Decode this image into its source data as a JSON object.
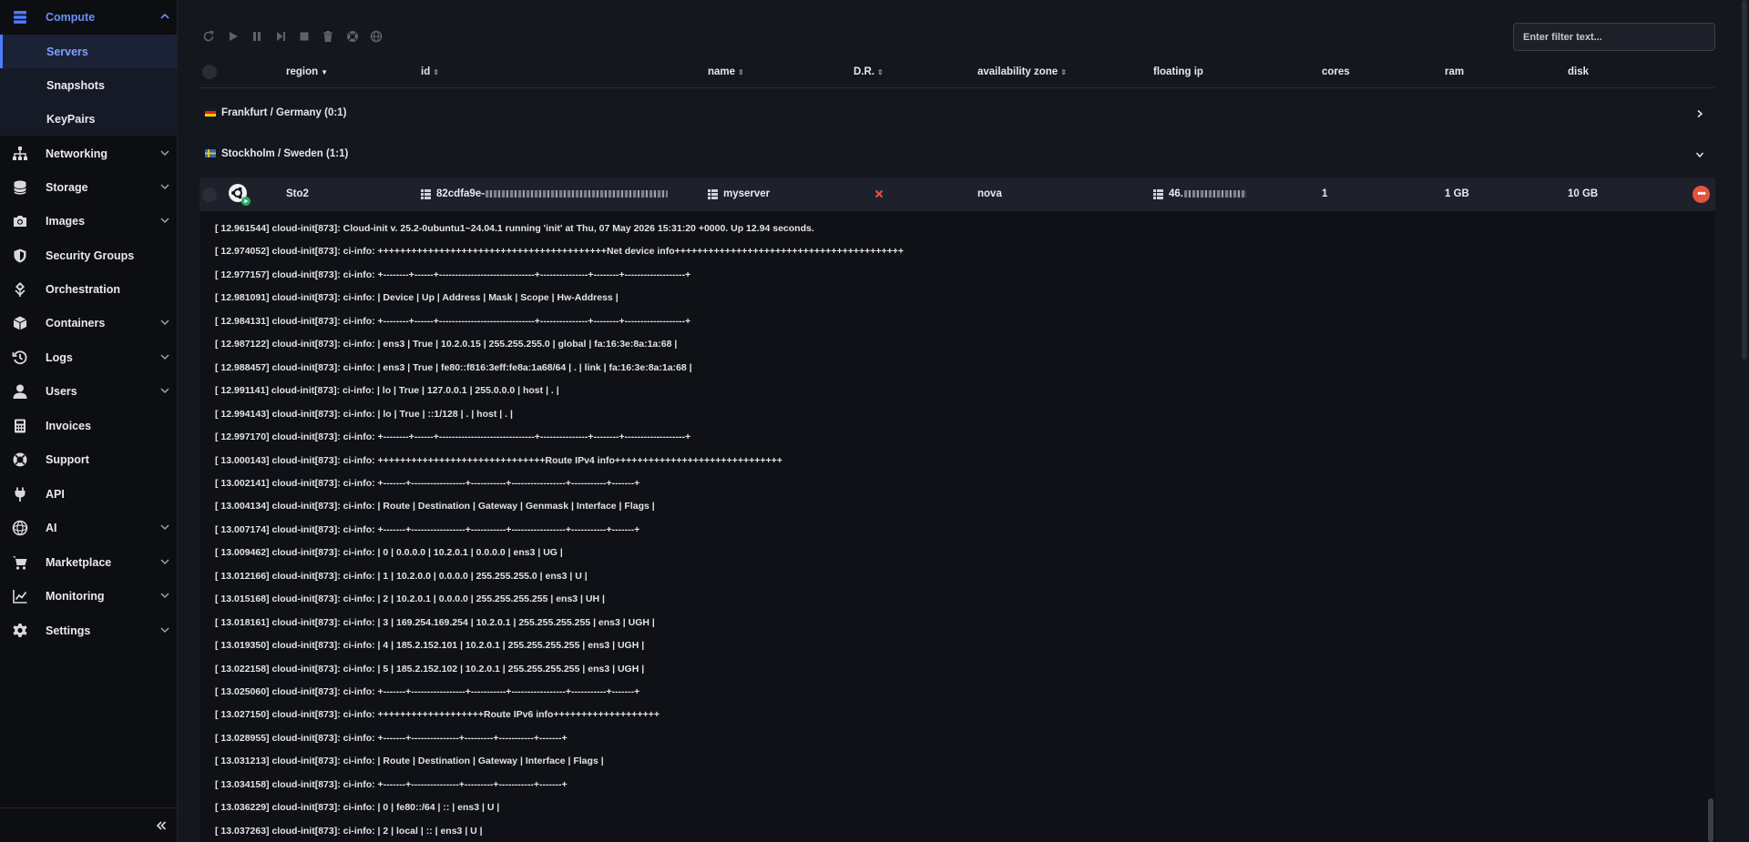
{
  "colors": {
    "accent": "#4f7cff",
    "danger": "#e5533d",
    "background": "#15171e",
    "sidebar": "#0d0e12"
  },
  "sidebar": {
    "items": [
      {
        "key": "compute",
        "label": "Compute",
        "icon": "server-stack-icon",
        "expanded": true
      },
      {
        "key": "networking",
        "label": "Networking",
        "icon": "network-icon",
        "expanded": false
      },
      {
        "key": "storage",
        "label": "Storage",
        "icon": "database-icon",
        "expanded": false
      },
      {
        "key": "images",
        "label": "Images",
        "icon": "camera-icon",
        "expanded": false
      },
      {
        "key": "security-groups",
        "label": "Security Groups",
        "icon": "shield-icon"
      },
      {
        "key": "orchestration",
        "label": "Orchestration",
        "icon": "orchestration-icon"
      },
      {
        "key": "containers",
        "label": "Containers",
        "icon": "cube-icon",
        "expanded": false
      },
      {
        "key": "logs",
        "label": "Logs",
        "icon": "history-icon",
        "expanded": false
      },
      {
        "key": "users",
        "label": "Users",
        "icon": "user-icon",
        "expanded": false
      },
      {
        "key": "invoices",
        "label": "Invoices",
        "icon": "calculator-icon"
      },
      {
        "key": "support",
        "label": "Support",
        "icon": "lifebuoy-icon"
      },
      {
        "key": "api",
        "label": "API",
        "icon": "plug-icon"
      },
      {
        "key": "ai",
        "label": "AI",
        "icon": "ai-icon",
        "expanded": false
      },
      {
        "key": "marketplace",
        "label": "Marketplace",
        "icon": "cart-icon",
        "expanded": false
      },
      {
        "key": "monitoring",
        "label": "Monitoring",
        "icon": "chart-line-icon",
        "expanded": false
      },
      {
        "key": "settings",
        "label": "Settings",
        "icon": "gear-icon",
        "expanded": false
      }
    ],
    "compute_sub": [
      {
        "label": "Servers",
        "active": true
      },
      {
        "label": "Snapshots",
        "active": false
      },
      {
        "label": "KeyPairs",
        "active": false
      }
    ],
    "collapse_icon": "double-chevron-left-icon"
  },
  "toolbar": {
    "icons": [
      "refresh-icon",
      "play-icon",
      "pause-icon",
      "skip-icon",
      "stop-icon",
      "trash-icon",
      "lifebuoy-icon",
      "globe-icon"
    ],
    "filter_placeholder": "Enter filter text..."
  },
  "table": {
    "columns": [
      {
        "label": "region",
        "sort": "desc"
      },
      {
        "label": "id",
        "sort": "none"
      },
      {
        "label": "name",
        "sort": "none"
      },
      {
        "label": "D.R.",
        "sort": "none"
      },
      {
        "label": "availability zone",
        "sort": "none"
      },
      {
        "label": "floating ip"
      },
      {
        "label": "cores"
      },
      {
        "label": "ram"
      },
      {
        "label": "disk"
      }
    ],
    "groups": [
      {
        "label": "Frankfurt / Germany (0:1)",
        "flag": "de",
        "expanded": false
      },
      {
        "label": "Stockholm / Sweden (1:1)",
        "flag": "se",
        "expanded": true
      }
    ],
    "server": {
      "region": "Sto2",
      "id_prefix": "82cdfa9e-",
      "name": "myserver",
      "dr": "disabled",
      "availability_zone": "nova",
      "floating_ip_prefix": "46.",
      "cores": "1",
      "ram": "1 GB",
      "disk": "10 GB",
      "status": "running"
    }
  },
  "console": {
    "lines": [
      "[ 12.961544] cloud-init[873]: Cloud-init v. 25.2-0ubuntu1~24.04.1 running 'init' at Thu, 07 May 2026 15:31:20 +0000. Up 12.94 seconds.",
      "[ 12.974052] cloud-init[873]: ci-info: +++++++++++++++++++++++++++++++++++++++++Net device info+++++++++++++++++++++++++++++++++++++++++",
      "[ 12.977157] cloud-init[873]: ci-info: +--------+------+------------------------------+---------------+--------+-------------------+",
      "[ 12.981091] cloud-init[873]: ci-info: | Device | Up | Address | Mask | Scope | Hw-Address |",
      "[ 12.984131] cloud-init[873]: ci-info: +--------+------+------------------------------+---------------+--------+-------------------+",
      "[ 12.987122] cloud-init[873]: ci-info: | ens3 | True | 10.2.0.15 | 255.255.255.0 | global | fa:16:3e:8a:1a:68 |",
      "[ 12.988457] cloud-init[873]: ci-info: | ens3 | True | fe80::f816:3eff:fe8a:1a68/64 | . | link | fa:16:3e:8a:1a:68 |",
      "[ 12.991141] cloud-init[873]: ci-info: | lo | True | 127.0.0.1 | 255.0.0.0 | host | . |",
      "[ 12.994143] cloud-init[873]: ci-info: | lo | True | ::1/128 | . | host | . |",
      "[ 12.997170] cloud-init[873]: ci-info: +--------+------+------------------------------+---------------+--------+-------------------+",
      "[ 13.000143] cloud-init[873]: ci-info: ++++++++++++++++++++++++++++++Route IPv4 info++++++++++++++++++++++++++++++",
      "[ 13.002141] cloud-init[873]: ci-info: +-------+-----------------+-----------+-----------------+-----------+-------+",
      "[ 13.004134] cloud-init[873]: ci-info: | Route | Destination | Gateway | Genmask | Interface | Flags |",
      "[ 13.007174] cloud-init[873]: ci-info: +-------+-----------------+-----------+-----------------+-----------+-------+",
      "[ 13.009462] cloud-init[873]: ci-info: | 0 | 0.0.0.0 | 10.2.0.1 | 0.0.0.0 | ens3 | UG |",
      "[ 13.012166] cloud-init[873]: ci-info: | 1 | 10.2.0.0 | 0.0.0.0 | 255.255.255.0 | ens3 | U |",
      "[ 13.015168] cloud-init[873]: ci-info: | 2 | 10.2.0.1 | 0.0.0.0 | 255.255.255.255 | ens3 | UH |",
      "[ 13.018161] cloud-init[873]: ci-info: | 3 | 169.254.169.254 | 10.2.0.1 | 255.255.255.255 | ens3 | UGH |",
      "[ 13.019350] cloud-init[873]: ci-info: | 4 | 185.2.152.101 | 10.2.0.1 | 255.255.255.255 | ens3 | UGH |",
      "[ 13.022158] cloud-init[873]: ci-info: | 5 | 185.2.152.102 | 10.2.0.1 | 255.255.255.255 | ens3 | UGH |",
      "[ 13.025060] cloud-init[873]: ci-info: +-------+-----------------+-----------+-----------------+-----------+-------+",
      "[ 13.027150] cloud-init[873]: ci-info: +++++++++++++++++++Route IPv6 info+++++++++++++++++++",
      "[ 13.028955] cloud-init[873]: ci-info: +-------+---------------+---------+-----------+-------+",
      "[ 13.031213] cloud-init[873]: ci-info: | Route | Destination | Gateway | Interface | Flags |",
      "[ 13.034158] cloud-init[873]: ci-info: +-------+---------------+---------+-----------+-------+",
      "[ 13.036229] cloud-init[873]: ci-info: | 0 | fe80::/64 | :: | ens3 | U |",
      "[ 13.037263] cloud-init[873]: ci-info: | 2 | local | :: | ens3 | U |"
    ]
  }
}
